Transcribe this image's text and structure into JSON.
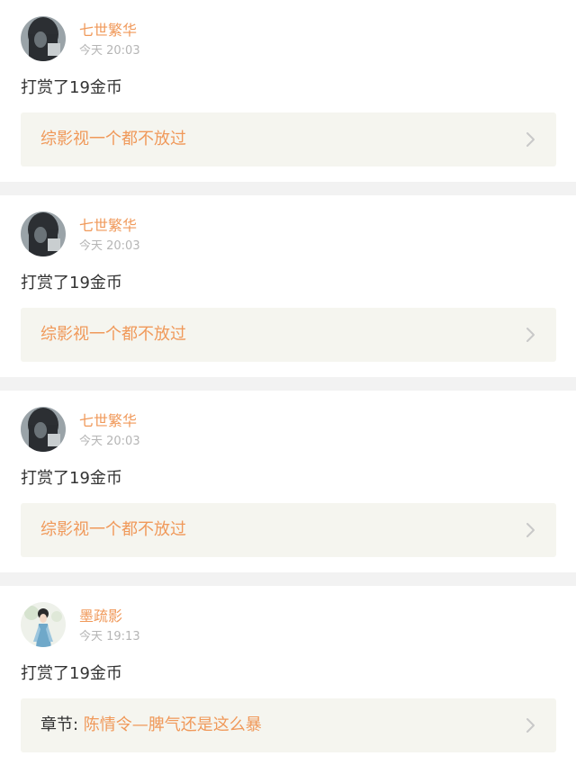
{
  "feed": [
    {
      "username": "七世繁华",
      "time": "今天 20:03",
      "action": "打赏了19金币",
      "ref_prefix": "",
      "ref_title": "综影视一个都不放过",
      "avatar_icon": "dark-hair-avatar"
    },
    {
      "username": "七世繁华",
      "time": "今天 20:03",
      "action": "打赏了19金币",
      "ref_prefix": "",
      "ref_title": "综影视一个都不放过",
      "avatar_icon": "dark-hair-avatar"
    },
    {
      "username": "七世繁华",
      "time": "今天 20:03",
      "action": "打赏了19金币",
      "ref_prefix": "",
      "ref_title": "综影视一个都不放过",
      "avatar_icon": "dark-hair-avatar"
    },
    {
      "username": "墨疏影",
      "time": "今天 19:13",
      "action": "打赏了19金币",
      "ref_prefix": "章节: ",
      "ref_title": "陈情令—脾气还是这么暴",
      "avatar_icon": "costume-girl-avatar"
    }
  ],
  "colors": {
    "accent": "#f0995a",
    "text": "#333333",
    "muted": "#b5b5b5",
    "ref_bg": "#f5f5ef",
    "divider": "#f2f2f2"
  }
}
